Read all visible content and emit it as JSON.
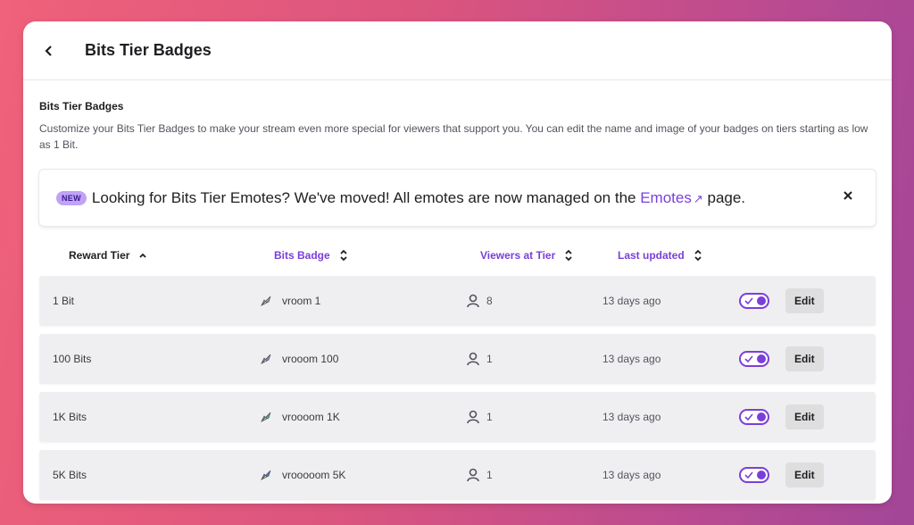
{
  "header": {
    "title": "Bits Tier Badges"
  },
  "section": {
    "title": "Bits Tier Badges",
    "description": "Customize your Bits Tier Badges to make your stream even more special for viewers that support you. You can edit the name and image of your badges on tiers starting as low as 1 Bit."
  },
  "notice": {
    "badge": "NEW",
    "text_before": "Looking for Bits Tier Emotes? We've moved! All emotes are now managed on the ",
    "link": "Emotes",
    "text_after": " page."
  },
  "columns": {
    "reward_tier": "Reward Tier",
    "bits_badge": "Bits Badge",
    "viewers_at_tier": "Viewers at Tier",
    "last_updated": "Last updated"
  },
  "rows": [
    {
      "tier": "1 Bit",
      "badge": "vroom 1",
      "viewers": "8",
      "updated": "13 days ago",
      "edit": "Edit",
      "badge_color": "#9a9aa0",
      "enabled": true
    },
    {
      "tier": "100 Bits",
      "badge": "vrooom 100",
      "viewers": "1",
      "updated": "13 days ago",
      "edit": "Edit",
      "badge_color": "#a970e0",
      "enabled": true
    },
    {
      "tier": "1K Bits",
      "badge": "vroooom 1K",
      "viewers": "1",
      "updated": "13 days ago",
      "edit": "Edit",
      "badge_color": "#2fb59a",
      "enabled": true
    },
    {
      "tier": "5K Bits",
      "badge": "vrooooom 5K",
      "viewers": "1",
      "updated": "13 days ago",
      "edit": "Edit",
      "badge_color": "#3d7ce8",
      "enabled": true
    }
  ],
  "colors": {
    "accent": "#7b3fd9",
    "row_bg": "#efeff1"
  }
}
